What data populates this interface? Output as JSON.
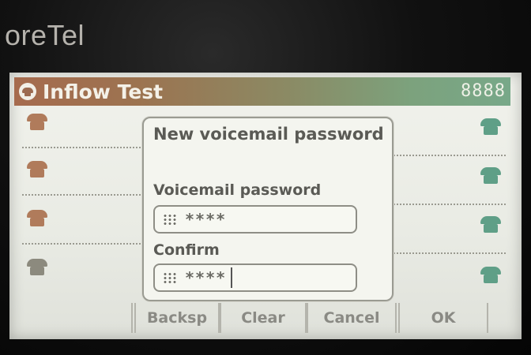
{
  "device": {
    "brand_text": "oreTel"
  },
  "titlebar": {
    "title": "Inflow Test",
    "extension": "8888"
  },
  "line_keys": {
    "left_count": 4,
    "right_count": 4
  },
  "dialog": {
    "title": "New voicemail password",
    "password_label": "Voicemail password",
    "password_value": "****",
    "confirm_label": "Confirm",
    "confirm_value": "****"
  },
  "softkeys": [
    {
      "label": ""
    },
    {
      "label": "Backsp"
    },
    {
      "label": "Clear"
    },
    {
      "label": "Cancel"
    },
    {
      "label": "OK"
    }
  ],
  "colors": {
    "title_left": "#a66b4e",
    "title_right": "#78a889",
    "line_left": "#b07b5b",
    "line_right": "#5f9f87"
  }
}
